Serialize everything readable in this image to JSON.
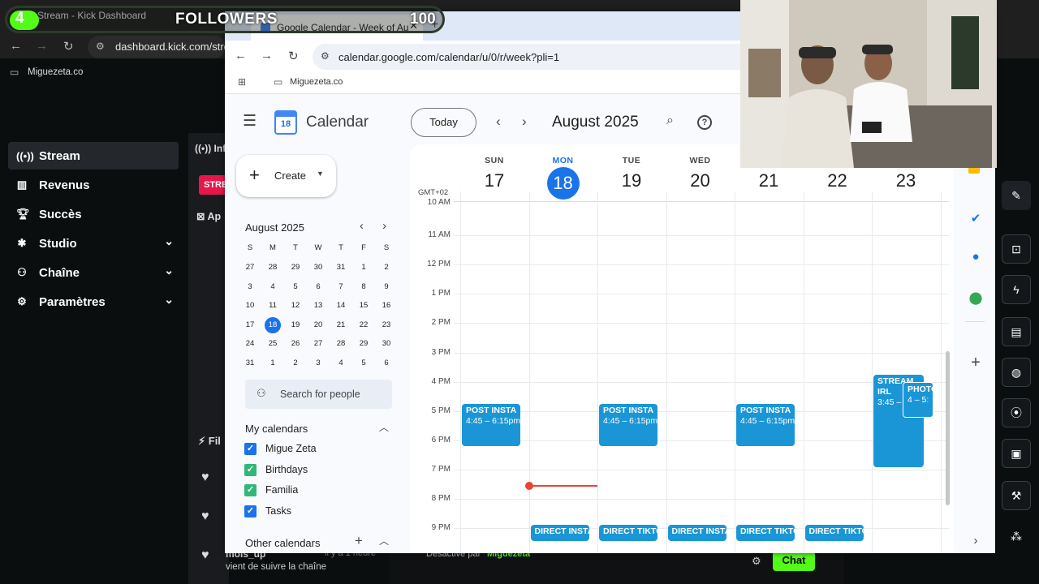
{
  "outer": {
    "tab_title": "Stream - Kick Dashboard",
    "url": "dashboard.kick.com/stre",
    "bookmark": "Miguezeta.co"
  },
  "followers": {
    "count_left": "4",
    "label": "FOLLOWERS",
    "goal": "100",
    "progress": 0.04
  },
  "kick": {
    "menu": [
      {
        "label": "Stream"
      },
      {
        "label": "Revenus"
      },
      {
        "label": "Succès"
      },
      {
        "label": "Studio"
      },
      {
        "label": "Chaîne"
      },
      {
        "label": "Paramètres"
      }
    ],
    "partial": {
      "info": "Inf",
      "badge": "STRE",
      "app": "Ap",
      "fil": "Fil"
    },
    "follower_event": {
      "user": "mois_up",
      "time": "il y a 1 heure",
      "text": "vient de suivre la chaîne"
    },
    "chat_notice": "Désactivé par",
    "chat_notice_user": "Miguezeta",
    "chat_button": "Chat",
    "accent": "#53fc18"
  },
  "gcal": {
    "tab_title": "Google Calendar - Week of Au",
    "url": "calendar.google.com/calendar/u/0/r/week?pli=1",
    "bookmark": "Miguezeta.co",
    "app_name": "Calendar",
    "today_button": "Today",
    "period_title": "August 2025",
    "create_label": "Create",
    "mini": {
      "title": "August 2025",
      "weekdays": [
        "S",
        "M",
        "T",
        "W",
        "T",
        "F",
        "S"
      ],
      "weeks": [
        [
          "27",
          "28",
          "29",
          "30",
          "31",
          "1",
          "2"
        ],
        [
          "3",
          "4",
          "5",
          "6",
          "7",
          "8",
          "9"
        ],
        [
          "10",
          "11",
          "12",
          "13",
          "14",
          "15",
          "16"
        ],
        [
          "17",
          "18",
          "19",
          "20",
          "21",
          "22",
          "23"
        ],
        [
          "24",
          "25",
          "26",
          "27",
          "28",
          "29",
          "30"
        ],
        [
          "31",
          "1",
          "2",
          "3",
          "4",
          "5",
          "6"
        ]
      ]
    },
    "search_people": "Search for people",
    "my_calendars_title": "My calendars",
    "my_calendars": [
      {
        "name": "Migue Zeta",
        "color": "#1a73e8"
      },
      {
        "name": "Birthdays",
        "color": "#33b679"
      },
      {
        "name": "Familia",
        "color": "#33b679"
      },
      {
        "name": "Tasks",
        "color": "#1a73e8"
      }
    ],
    "other_calendars_title": "Other calendars",
    "timezone": "GMT+02",
    "days": [
      {
        "name": "SUN",
        "num": "17"
      },
      {
        "name": "MON",
        "num": "18",
        "today": true
      },
      {
        "name": "TUE",
        "num": "19"
      },
      {
        "name": "WED",
        "num": "20"
      },
      {
        "name": "THU",
        "num": "21"
      },
      {
        "name": "FRI",
        "num": "22"
      },
      {
        "name": "SAT",
        "num": "23"
      }
    ],
    "hours": [
      "10 AM",
      "11 AM",
      "12 PM",
      "1 PM",
      "2 PM",
      "3 PM",
      "4 PM",
      "5 PM",
      "6 PM",
      "7 PM",
      "8 PM",
      "9 PM"
    ],
    "events": [
      {
        "day": 0,
        "title": "POST INSTA",
        "time": "4:45 – 6:15pm"
      },
      {
        "day": 2,
        "title": "POST INSTA",
        "time": "4:45 – 6:15pm"
      },
      {
        "day": 4,
        "title": "POST INSTA",
        "time": "4:45 – 6:15pm"
      },
      {
        "day": 6,
        "title": "STREAM IRL",
        "time": "3:45 –"
      },
      {
        "day": 6,
        "title": "PHOTO",
        "time": "4 – 5:"
      }
    ],
    "bottom_events": [
      {
        "day": 1,
        "title": "DIRECT INSTA"
      },
      {
        "day": 2,
        "title": "DIRECT TIKTO"
      },
      {
        "day": 3,
        "title": "DIRECT INSTA"
      },
      {
        "day": 4,
        "title": "DIRECT TIKTO"
      },
      {
        "day": 5,
        "title": "DIRECT TIKTO"
      }
    ],
    "accent": "#1a73e8",
    "event_color": "#1a96d6"
  }
}
